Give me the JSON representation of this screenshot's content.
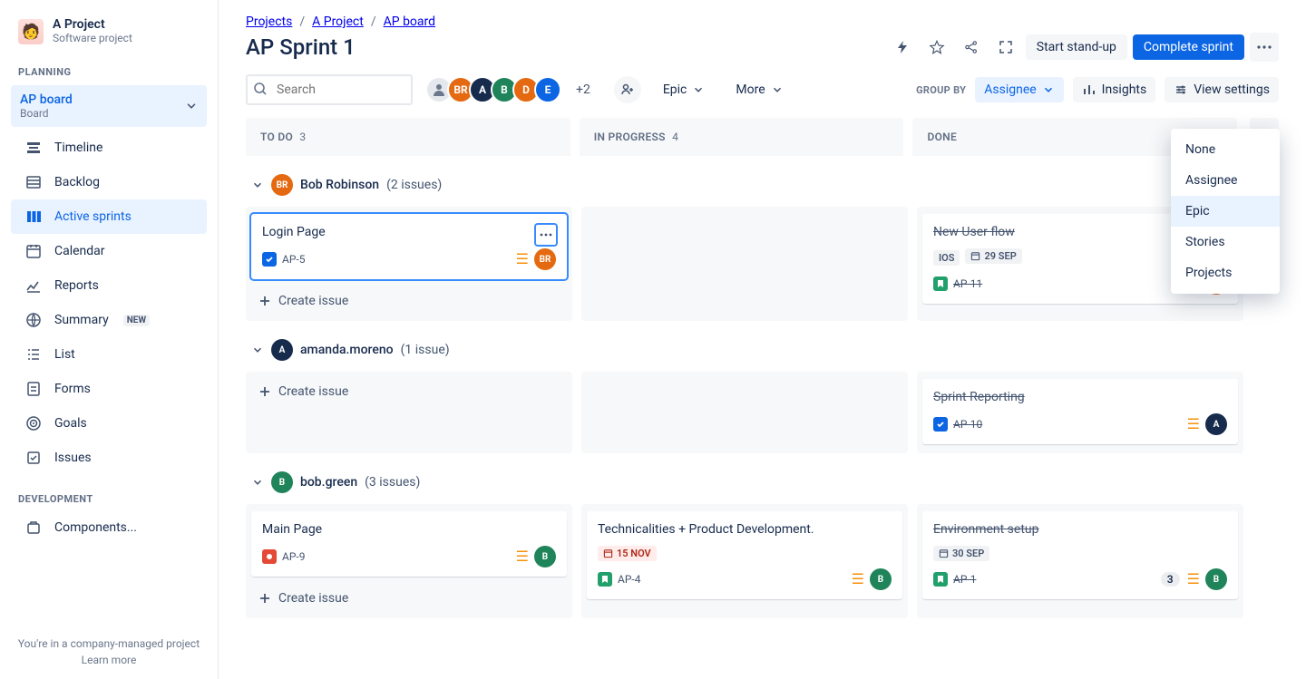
{
  "project": {
    "name": "A Project",
    "subtitle": "Software project"
  },
  "sidebar": {
    "planning_caption": "PLANNING",
    "dev_caption": "DEVELOPMENT",
    "selector": {
      "line1": "AP board",
      "line2": "Board"
    },
    "items": [
      {
        "label": "Timeline"
      },
      {
        "label": "Backlog"
      },
      {
        "label": "Active sprints"
      },
      {
        "label": "Calendar"
      },
      {
        "label": "Reports"
      },
      {
        "label": "Summary",
        "badge": "NEW"
      },
      {
        "label": "List"
      },
      {
        "label": "Forms"
      },
      {
        "label": "Goals"
      },
      {
        "label": "Issues"
      }
    ],
    "dev_items": [
      {
        "label": "Components..."
      }
    ],
    "footer": "You're in a company-managed project",
    "learn": "Learn more"
  },
  "breadcrumbs": [
    "Projects",
    "A Project",
    "AP board"
  ],
  "page_title": "AP Sprint 1",
  "header_btns": {
    "standup": "Start stand-up",
    "complete": "Complete sprint"
  },
  "search": {
    "placeholder": "Search"
  },
  "avatars": [
    {
      "t": "",
      "bg": "#E5E8EC",
      "fg": "#6B778C",
      "svg": true
    },
    {
      "t": "BR",
      "bg": "#E56910"
    },
    {
      "t": "A",
      "bg": "#172B4D"
    },
    {
      "t": "B",
      "bg": "#1F845A"
    },
    {
      "t": "D",
      "bg": "#E56910"
    },
    {
      "t": "E",
      "bg": "#0C66E4"
    }
  ],
  "overflow_avs": "+2",
  "filters": {
    "epic": "Epic",
    "more": "More"
  },
  "group_by_label": "GROUP BY",
  "group_by_value": "Assignee",
  "insights": "Insights",
  "view_settings": "View settings",
  "dropdown": {
    "opts": [
      "None",
      "Assignee",
      "Epic",
      "Stories",
      "Projects"
    ],
    "sel": "Epic"
  },
  "columns": [
    {
      "name": "TO DO",
      "count": "3"
    },
    {
      "name": "IN PROGRESS",
      "count": "4"
    },
    {
      "name": "DONE"
    }
  ],
  "create_issue": "Create issue",
  "swimlanes": [
    {
      "assignee": {
        "initials": "BR",
        "bg": "#E56910",
        "name": "Bob Robinson"
      },
      "issues_label": "(2 issues)",
      "cells": [
        {
          "cards": [
            {
              "title": "Login Page",
              "type": "task",
              "key": "AP-5",
              "av": {
                "t": "BR",
                "bg": "#E56910"
              },
              "focus": true
            }
          ],
          "create": true
        },
        {
          "cards": []
        },
        {
          "cards": [
            {
              "title": "New User flow",
              "type": "story",
              "key": "AP-11",
              "done": true,
              "av": {
                "t": "BR",
                "bg": "#E56910"
              },
              "tag": "IOS",
              "date": "29 SEP",
              "dateStyle": "grey"
            }
          ]
        }
      ]
    },
    {
      "assignee": {
        "initials": "A",
        "bg": "#172B4D",
        "name": "amanda.moreno"
      },
      "issues_label": "(1 issue)",
      "cells": [
        {
          "cards": [],
          "create": true
        },
        {
          "cards": []
        },
        {
          "cards": [
            {
              "title": "Sprint Reporting",
              "type": "task",
              "key": "AP-10",
              "done": true,
              "av": {
                "t": "A",
                "bg": "#172B4D"
              }
            }
          ]
        }
      ]
    },
    {
      "assignee": {
        "initials": "B",
        "bg": "#1F845A",
        "name": "bob.green"
      },
      "issues_label": "(3 issues)",
      "cells": [
        {
          "cards": [
            {
              "title": "Main Page",
              "type": "bug",
              "key": "AP-9",
              "av": {
                "t": "B",
                "bg": "#1F845A"
              }
            }
          ],
          "create": true
        },
        {
          "cards": [
            {
              "title": "Technicalities + Product Development.",
              "type": "story",
              "key": "AP-4",
              "av": {
                "t": "B",
                "bg": "#1F845A"
              },
              "date": "15 NOV",
              "dateStyle": "red"
            }
          ]
        },
        {
          "cards": [
            {
              "title": "Environment setup",
              "type": "story",
              "key": "AP-1",
              "done": true,
              "av": {
                "t": "B",
                "bg": "#1F845A"
              },
              "date": "30 SEP",
              "dateStyle": "grey",
              "story_pts": "3"
            }
          ]
        }
      ]
    }
  ]
}
